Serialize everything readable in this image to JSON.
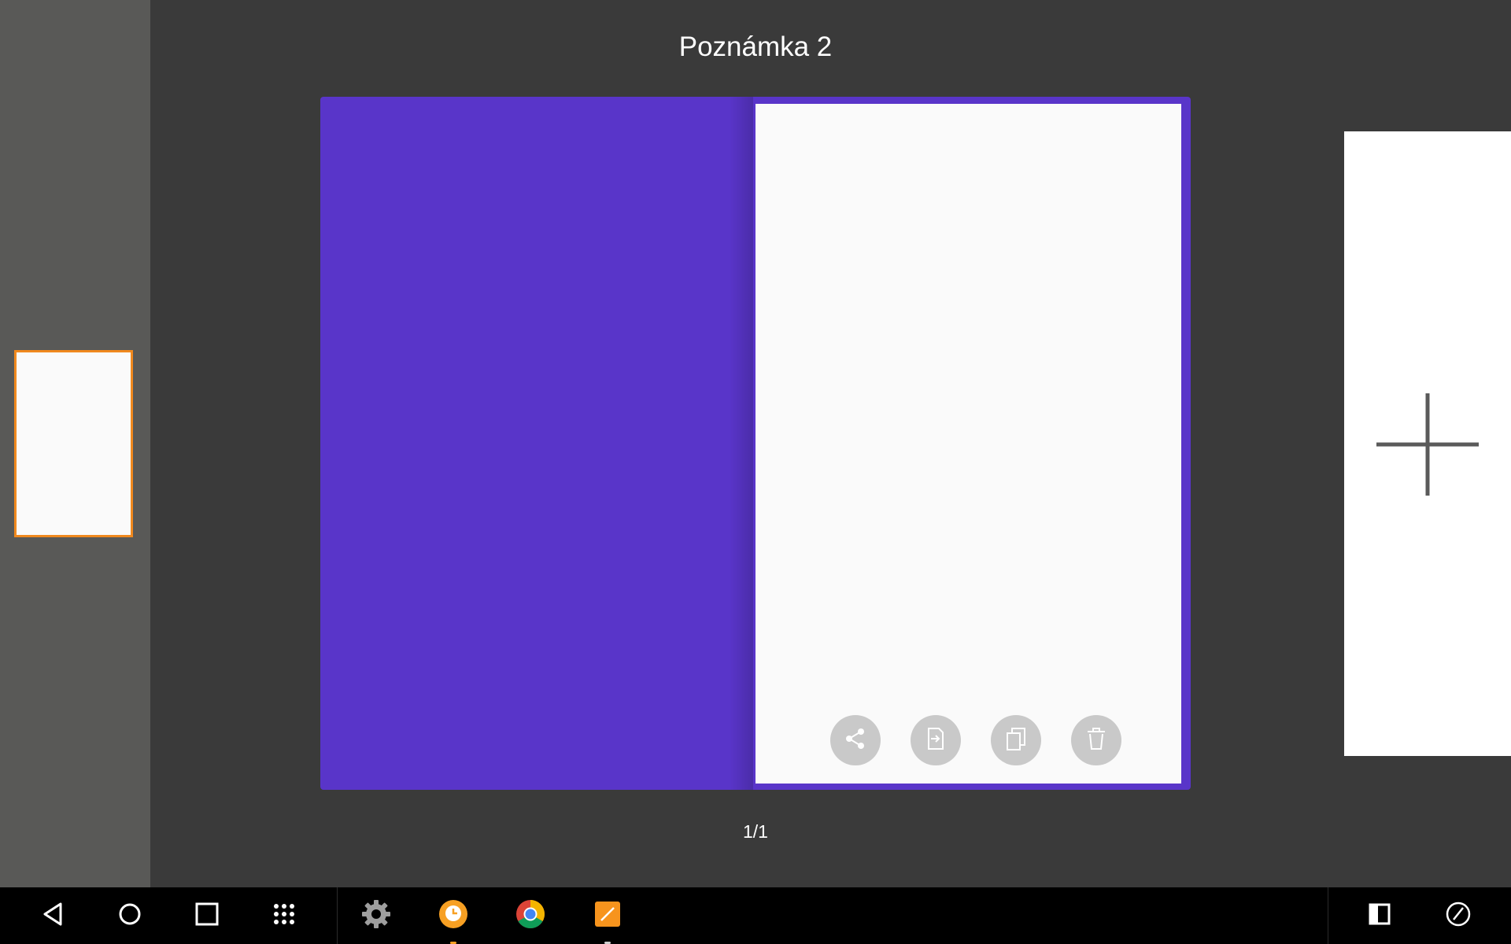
{
  "window": {
    "title": "Poznámka 2"
  },
  "pager": {
    "text": "1/1"
  },
  "colors": {
    "cover": "#5935c9",
    "page": "#fafafa",
    "thumb_border": "#f0891e",
    "action_button": "#c9c9c9"
  },
  "actions": [
    {
      "icon": "share-icon"
    },
    {
      "icon": "export-icon"
    },
    {
      "icon": "copy-icon"
    },
    {
      "icon": "delete-icon"
    }
  ],
  "new_note": {
    "icon": "plus-icon"
  },
  "taskbar": {
    "nav": [
      "back-icon",
      "home-icon",
      "recents-icon",
      "app-drawer-icon"
    ],
    "apps": [
      "settings-icon",
      "reminder-app-icon",
      "chrome-icon",
      "notes-app-icon"
    ],
    "right": [
      "split-screen-icon",
      "pen-icon"
    ]
  }
}
